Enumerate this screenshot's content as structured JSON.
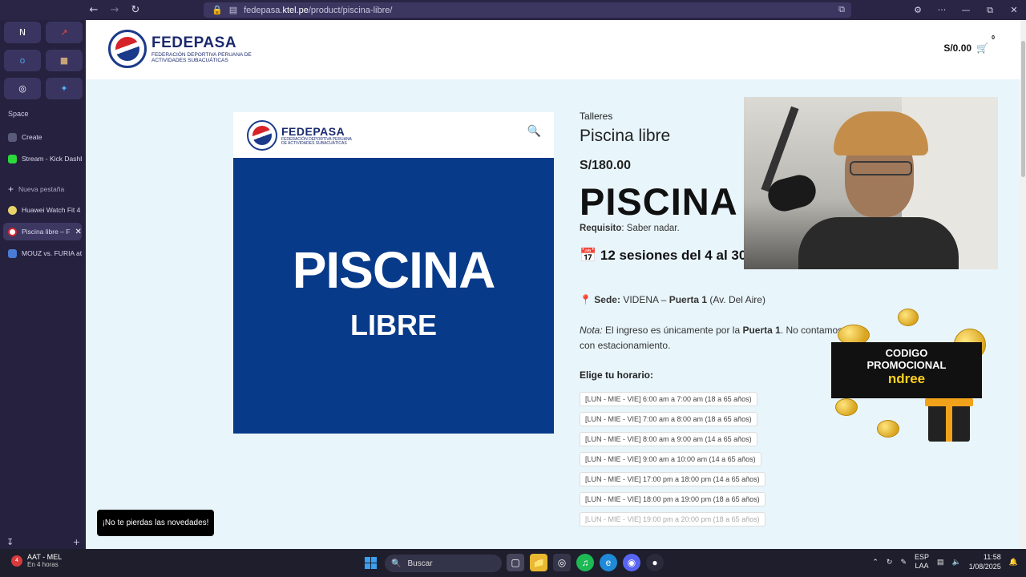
{
  "browser": {
    "url_prefix": "fedepasa.",
    "url_domain": "ktel.pe",
    "url_path": "/product/piscina-libre/",
    "pins": [
      "N",
      "↗",
      "o",
      "■",
      "◎",
      "✦"
    ],
    "space_label": "Space",
    "tabs": [
      {
        "label": "Create"
      },
      {
        "label": "Stream - Kick Dashb"
      },
      {
        "label": "Nueva pestaña"
      },
      {
        "label": "Huawei Watch Fit 4"
      },
      {
        "label": "Piscina libre – F"
      },
      {
        "label": "MOUZ vs. FURIA at"
      }
    ]
  },
  "site": {
    "logo_name": "FEDEPASA",
    "logo_sub": "Federación Deportiva Peruana de Actividades Subacuáticas",
    "cart_total": "S/0.00",
    "cart_count": "0"
  },
  "product_image": {
    "title": "PISCINA",
    "subtitle": "LIBRE"
  },
  "product": {
    "category": "Talleres",
    "title": "Piscina libre",
    "price": "S/180.00",
    "hero": "PISCINA LIBRE",
    "req_label": "Requisito",
    "req_value": ": Saber nadar.",
    "sessions": "12 sesiones del 4 al 30 de agosto",
    "sede_label": "Sede:",
    "sede_place": " VIDENA – ",
    "sede_gate": "Puerta 1",
    "sede_rest": " (Av. Del Aire)",
    "nota_label": "Nota:",
    "nota_text_1": " El ingreso es únicamente por la ",
    "nota_gate": "Puerta 1",
    "nota_text_2": ". No contamos con estacionamiento.",
    "choose_label": "Elige tu horario:",
    "schedules": [
      "[LUN - MIE - VIE] 6:00 am a 7:00 am (18 a 65 años)",
      "[LUN - MIE - VIE] 7:00 am a 8:00 am (18 a 65 años)",
      "[LUN - MIE - VIE] 8:00 am a 9:00 am (14 a 65 años)",
      "[LUN - MIE - VIE] 9:00 am a 10:00 am (14 a 65 años)",
      "[LUN - MIE - VIE] 17:00 pm a 18:00 pm (14 a 65 años)",
      "[LUN - MIE - VIE] 18:00 pm a 19:00 pm (18 a 65 años)",
      "[LUN - MIE - VIE] 19:00 pm a 20:00 pm (18 a 65 años)"
    ]
  },
  "promo": {
    "line1": "CODIGO",
    "line2": "PROMOCIONAL",
    "code": "ndree"
  },
  "toast": "¡No te pierdas las novedades!",
  "taskbar": {
    "weather_badge": "4",
    "weather_line1": "AAT - MEL",
    "weather_line2": "En 4 horas",
    "search_placeholder": "Buscar",
    "lang_1": "ESP",
    "lang_2": "LAA",
    "time": "11:58",
    "date": "1/08/2025"
  },
  "colors": {
    "page_bg": "#e8f5fb",
    "product_blue": "#083a8a",
    "promo_yellow": "#ffd21f",
    "sidebar_bg": "#25213f"
  }
}
